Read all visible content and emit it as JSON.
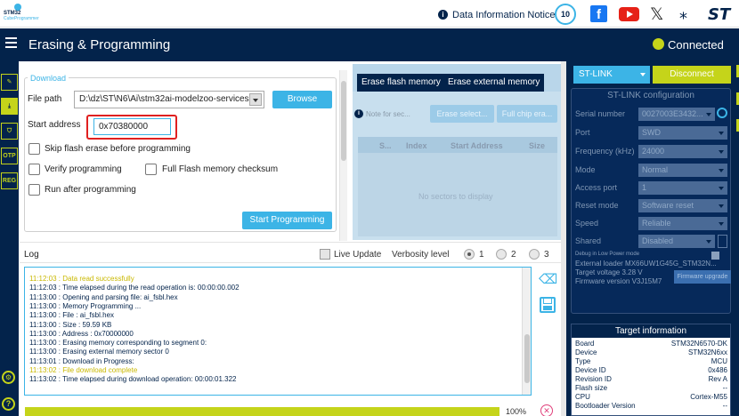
{
  "topbar": {
    "logo_line1": "STM32",
    "logo_line2": "CubeProgrammer",
    "notice": "Data Information Notice",
    "badge": "10",
    "fb_glyph": "f",
    "x_glyph": "𝕏",
    "net_glyph": "⁎",
    "st_glyph": "ST"
  },
  "header": {
    "title": "Erasing & Programming",
    "status": "Connected",
    "status_color": "#c5d41a"
  },
  "sidebar": {
    "items": [
      {
        "icon": "edit-icon",
        "label": "✎"
      },
      {
        "icon": "download-icon",
        "label": "⤓"
      },
      {
        "icon": "shield-icon",
        "label": "⛉"
      },
      {
        "icon": "otp-icon",
        "label": "OTP"
      },
      {
        "icon": "reg-icon",
        "label": "REG"
      }
    ],
    "help1": "⚙",
    "help2": "?"
  },
  "download": {
    "legend": "Download",
    "file_path_label": "File path",
    "file_path_value": "D:\\dz\\ST\\N6\\Ai\\stm32ai-modelzoo-services",
    "browse_label": "Browse",
    "start_address_label": "Start address",
    "start_address_value": "0x70380000",
    "skip_label": "Skip flash erase before programming",
    "verify_label": "Verify programming",
    "full_flash_label": "Full Flash memory checksum",
    "run_label": "Run after programming",
    "start_button": "Start Programming"
  },
  "erase": {
    "tabs": [
      "Erase flash memory",
      "Erase external memory"
    ],
    "note": "Note for sec...",
    "erase_selected": "Erase select...",
    "full_chip": "Full chip era...",
    "columns": [
      "S...",
      "Index",
      "Start Address",
      "Size"
    ],
    "empty": "No sectors to display"
  },
  "log": {
    "title": "Log",
    "live_update": "Live Update",
    "verbosity_label": "Verbosity level",
    "levels": [
      "1",
      "2",
      "3"
    ],
    "selected_level": "1",
    "lines": [
      {
        "text": "11:12:03 : Data read successfully",
        "color": "#c9b800"
      },
      {
        "text": "11:12:03 : Time elapsed during the read operation is: 00:00:00.002",
        "color": "#03234b"
      },
      {
        "text": "11:13:00 : Opening and parsing file: ai_fsbl.hex",
        "color": "#03234b"
      },
      {
        "text": "11:13:00 : Memory Programming ...",
        "color": "#03234b"
      },
      {
        "text": "11:13:00 :   File          : ai_fsbl.hex",
        "color": "#03234b"
      },
      {
        "text": "11:13:00 :   Size          : 59.59 KB",
        "color": "#03234b"
      },
      {
        "text": "11:13:00 :   Address       : 0x70000000",
        "color": "#03234b"
      },
      {
        "text": "11:13:00 : Erasing memory corresponding to segment 0:",
        "color": "#03234b"
      },
      {
        "text": "11:13:00 : Erasing external memory sector 0",
        "color": "#03234b"
      },
      {
        "text": "11:13:01 : Download in Progress:",
        "color": "#03234b"
      },
      {
        "text": "11:13:02 : File download complete",
        "color": "#c9b800"
      },
      {
        "text": "11:13:02 : Time elapsed during download operation: 00:00:01.322",
        "color": "#03234b"
      }
    ]
  },
  "progress": {
    "value_percent": 100,
    "label": "100%",
    "cancel_glyph": "✕"
  },
  "connection": {
    "interface": "ST-LINK",
    "disconnect": "Disconnect",
    "config_title": "ST-LINK configuration",
    "fields": [
      {
        "label": "Serial number",
        "value": "0027003E3432..."
      },
      {
        "label": "Port",
        "value": "SWD"
      },
      {
        "label": "Frequency (kHz)",
        "value": "24000"
      },
      {
        "label": "Mode",
        "value": "Normal"
      },
      {
        "label": "Access port",
        "value": "1"
      },
      {
        "label": "Reset mode",
        "value": "Software reset"
      },
      {
        "label": "Speed",
        "value": "Reliable"
      },
      {
        "label": "Shared",
        "value": "Disabled"
      }
    ],
    "debug_low_power": "Debug in Low Power mode",
    "external_loader": "External loader    MX66UW1G45G_STM32N...",
    "target_voltage": "Target voltage    3.28 V",
    "firmware_version": "Firmware version  V3J15M7",
    "firmware_upgrade": "Firmware upgrade"
  },
  "target": {
    "title": "Target information",
    "rows": [
      {
        "key": "Board",
        "value": "STM32N6570-DK"
      },
      {
        "key": "Device",
        "value": "STM32N6xx"
      },
      {
        "key": "Type",
        "value": "MCU"
      },
      {
        "key": "Device ID",
        "value": "0x486"
      },
      {
        "key": "Revision ID",
        "value": "Rev A"
      },
      {
        "key": "Flash size",
        "value": "--"
      },
      {
        "key": "CPU",
        "value": "Cortex-M55"
      },
      {
        "key": "Bootloader Version",
        "value": "--"
      }
    ]
  }
}
